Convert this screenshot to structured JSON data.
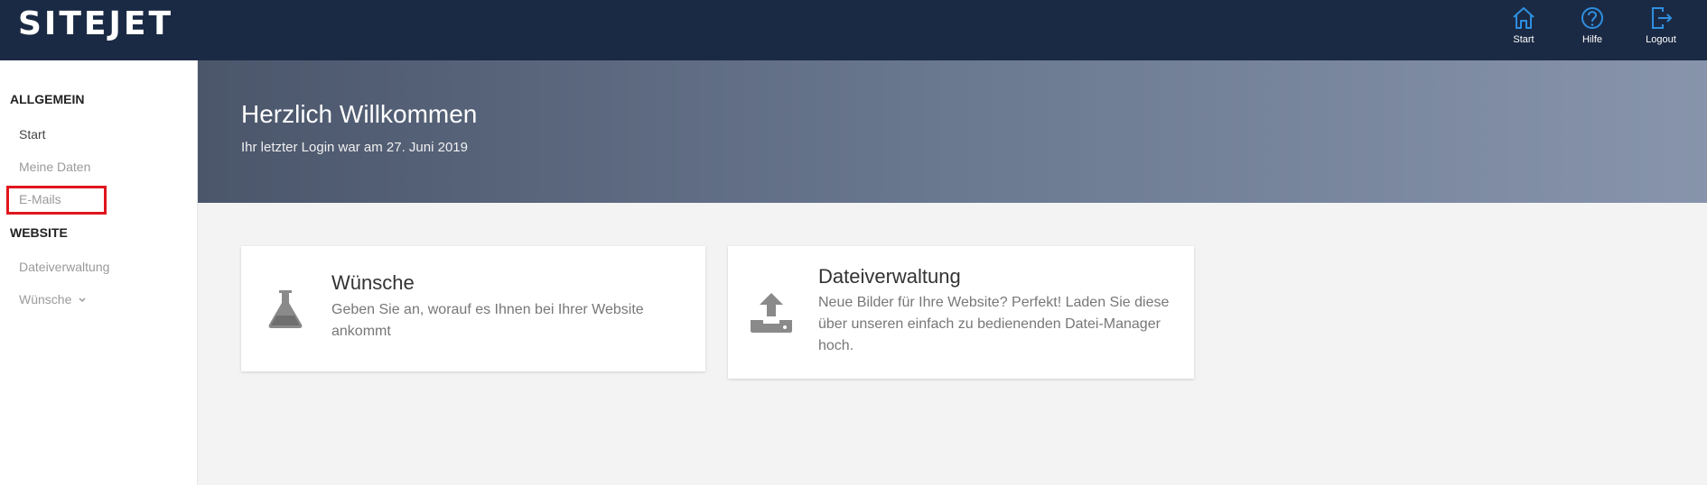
{
  "header": {
    "logo": "SITEJET",
    "nav": [
      {
        "label": "Start",
        "icon": "home-icon"
      },
      {
        "label": "Hilfe",
        "icon": "help-icon"
      },
      {
        "label": "Logout",
        "icon": "logout-icon"
      }
    ]
  },
  "sidebar": {
    "sections": [
      {
        "title": "ALLGEMEIN",
        "items": [
          "Start",
          "Meine Daten",
          "E-Mails"
        ]
      },
      {
        "title": "WEBSITE",
        "items": [
          "Dateiverwaltung",
          "Wünsche"
        ]
      }
    ]
  },
  "hero": {
    "title": "Herzlich Willkommen",
    "subtitle": "Ihr letzter Login war am 27. Juni 2019"
  },
  "cards": [
    {
      "title": "Wünsche",
      "text": "Geben Sie an, worauf es Ihnen bei Ihrer Website ankommt",
      "icon": "flask-icon"
    },
    {
      "title": "Dateiverwaltung",
      "text": "Neue Bilder für Ihre Website? Perfekt! Laden Sie diese über unseren einfach zu bedienenden Datei-Manager hoch.",
      "icon": "upload-icon"
    }
  ],
  "colors": {
    "header_bg": "#1b2a44",
    "nav_icon": "#2f8fe0",
    "highlight": "#e0151d"
  }
}
